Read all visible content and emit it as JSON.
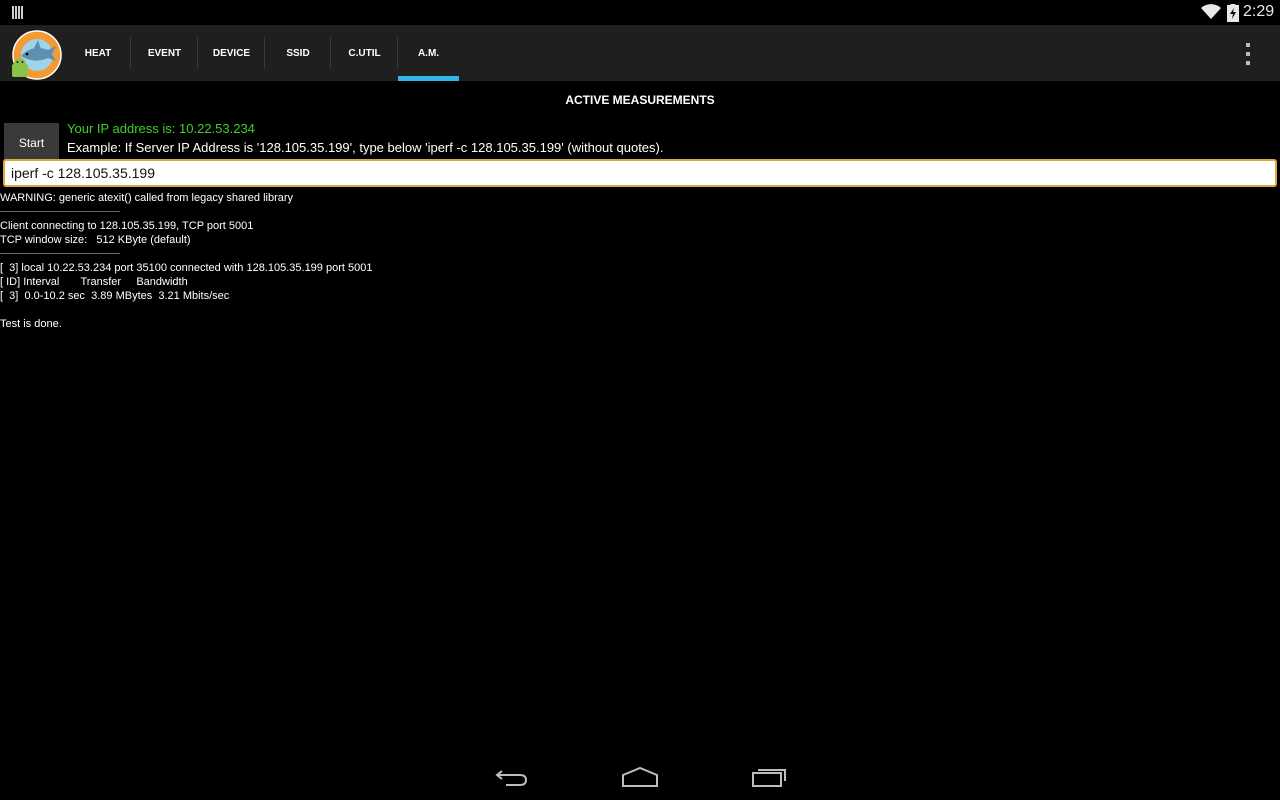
{
  "status_bar": {
    "time": "2:29",
    "icons": [
      "notification-icon",
      "wifi-icon",
      "battery-charging-icon"
    ]
  },
  "action_bar": {
    "logo_icon": "shark-android-logo-icon",
    "tabs": [
      {
        "label": "HEAT",
        "active": false
      },
      {
        "label": "EVENT",
        "active": false
      },
      {
        "label": "DEVICE",
        "active": false
      },
      {
        "label": "SSID",
        "active": false
      },
      {
        "label": "C.UTIL",
        "active": false
      },
      {
        "label": "A.M.",
        "active": true
      }
    ],
    "overflow_icon": "overflow-menu-icon",
    "accent_color": "#33b5e5"
  },
  "main": {
    "title": "ACTIVE MEASUREMENTS",
    "start_label": "Start",
    "ip_text": "Your IP address is: 10.22.53.234",
    "ip_color": "#3ecf2a",
    "example_text": "Example: If Server IP Address is '128.105.35.199', type below 'iperf -c 128.105.35.199' (without quotes).",
    "command_value": "iperf -c 128.105.35.199",
    "output_lines": [
      "WARNING: generic atexit() called from legacy shared library",
      "------------------------------------------------------------",
      "Client connecting to 128.105.35.199, TCP port 5001",
      "TCP window size:   512 KByte (default)",
      "------------------------------------------------------------",
      "[  3] local 10.22.53.234 port 35100 connected with 128.105.35.199 port 5001",
      "[ ID] Interval       Transfer     Bandwidth",
      "[  3]  0.0-10.2 sec  3.89 MBytes  3.21 Mbits/sec",
      "",
      "Test is done."
    ]
  },
  "nav_bar": {
    "buttons": [
      "back-icon",
      "home-icon",
      "recents-icon"
    ]
  }
}
